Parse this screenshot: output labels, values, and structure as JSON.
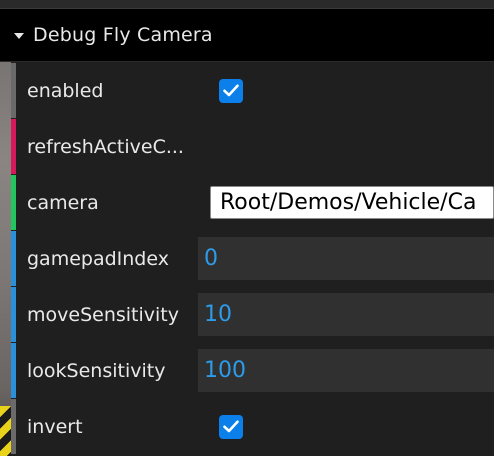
{
  "panel": {
    "title": "Debug Fly Camera"
  },
  "fields": {
    "enabled": {
      "label": "enabled",
      "checked": true,
      "accent": "#6a6a6a"
    },
    "refresh": {
      "label": "refreshActiveC...",
      "accent": "#d6195b"
    },
    "camera": {
      "label": "camera",
      "value": "Root/Demos/Vehicle/Ca",
      "accent": "#22c55e"
    },
    "gamepadIndex": {
      "label": "gamepadIndex",
      "value": "0",
      "accent": "#2b8fd9"
    },
    "moveSensitivity": {
      "label": "moveSensitivity",
      "value": "10",
      "accent": "#2b8fd9"
    },
    "lookSensitivity": {
      "label": "lookSensitivity",
      "value": "100",
      "accent": "#2b8fd9"
    },
    "invert": {
      "label": "invert",
      "checked": true,
      "accent": "#6a6a6a"
    }
  },
  "colors": {
    "checkbox": "#0b7fea",
    "numberText": "#2d9be8"
  },
  "icons": {
    "collapse": "caret-down-icon",
    "check": "checkmark-icon"
  }
}
